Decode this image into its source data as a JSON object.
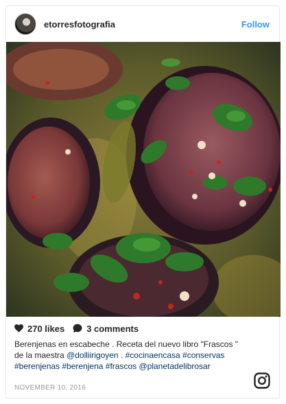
{
  "post": {
    "username": "etorresfotografia",
    "follow_label": "Follow",
    "likes": "270 likes",
    "comments": "3 comments",
    "caption": {
      "text_1": "Berenjenas en escabeche . Receta del nuevo libro \"Frascos \" de la maestra ",
      "mention_1": "@dolliirigoyen",
      "text_2": " . ",
      "tags": "#cocinaencasa #conservas #berenjenas #berenjena #frascos",
      "text_3": " ",
      "mention_2": "@planetadelibrosar"
    },
    "date": "NOVEMBER 10, 2016"
  },
  "icons": {
    "avatar": "avatar",
    "heart": "heart-icon",
    "comment": "comment-icon",
    "instagram": "instagram-logo-icon"
  },
  "colors": {
    "follow": "#3897f0",
    "tag": "#003569",
    "meta": "#999999"
  }
}
